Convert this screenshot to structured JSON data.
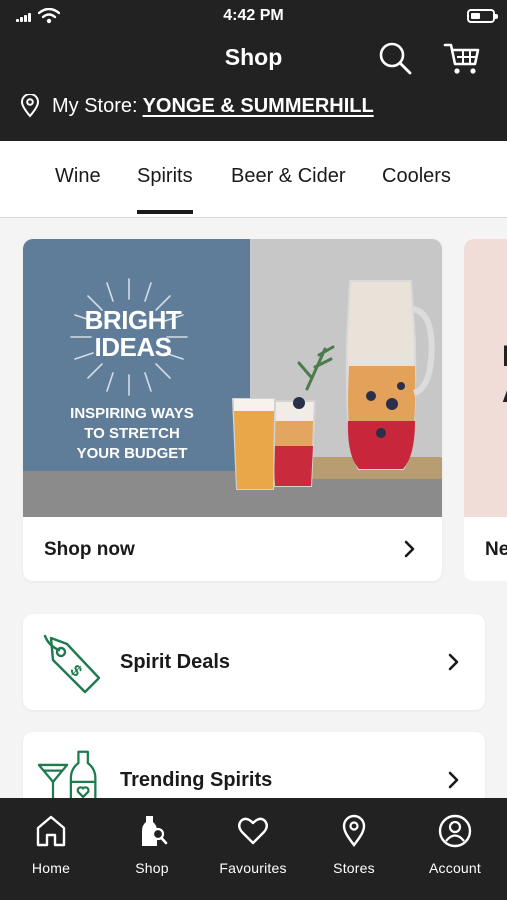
{
  "status_bar": {
    "time": "4:42 PM"
  },
  "header": {
    "title": "Shop"
  },
  "store": {
    "label": "My Store:",
    "name": "YONGE & SUMMERHILL"
  },
  "tabs": [
    {
      "label": "Wine",
      "active": false
    },
    {
      "label": "Spirits",
      "active": true
    },
    {
      "label": "Beer & Cider",
      "active": false
    },
    {
      "label": "Coolers",
      "active": false
    }
  ],
  "promo": {
    "headline_line1": "BRIGHT",
    "headline_line2": "IDEAS",
    "sub_line1": "INSPIRING WAYS",
    "sub_line2": "TO STRETCH",
    "sub_line3": "YOUR BUDGET",
    "cta": "Shop now"
  },
  "promo2": {
    "cta_partial": "Ne",
    "headline_partial_1": "I",
    "headline_partial_2": "A"
  },
  "rows": [
    {
      "label": "Spirit Deals",
      "icon": "price-tag-icon"
    },
    {
      "label": "Trending Spirits",
      "icon": "cocktail-bottle-icon"
    }
  ],
  "bottom_nav": [
    {
      "label": "Home",
      "icon": "home-icon"
    },
    {
      "label": "Shop",
      "icon": "shop-bottle-icon"
    },
    {
      "label": "Favourites",
      "icon": "heart-icon"
    },
    {
      "label": "Stores",
      "icon": "pin-icon"
    },
    {
      "label": "Account",
      "icon": "account-icon"
    }
  ],
  "colors": {
    "header_bg": "#222222",
    "accent_green": "#1f7a4d",
    "promo_blue": "#5f7d99"
  }
}
